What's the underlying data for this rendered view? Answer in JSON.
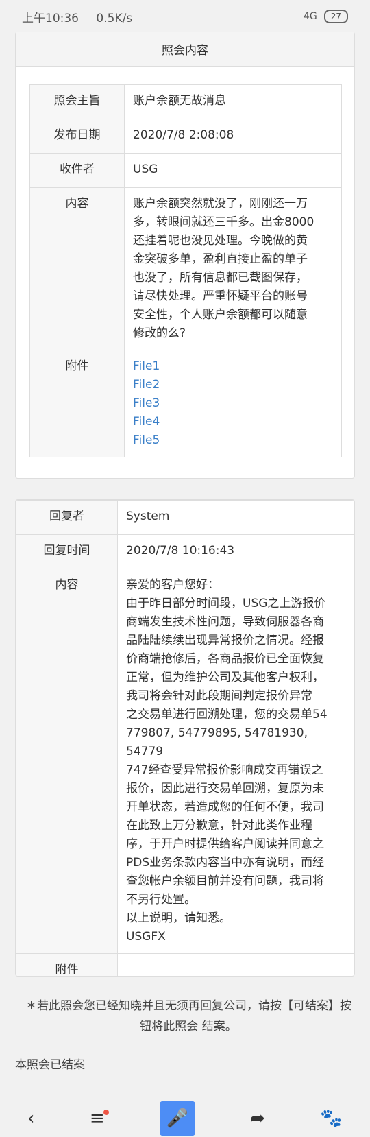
{
  "status": {
    "time": "上午10:36",
    "speed": "0.5K/s",
    "network": "4G",
    "battery": "27"
  },
  "inquiry": {
    "title": "照会内容",
    "subject_label": "照会主旨",
    "subject": "账户余额无故消息",
    "date_label": "发布日期",
    "date": "2020/7/8 2:08:08",
    "recipient_label": "收件者",
    "recipient": "USG",
    "content_label": "内容",
    "content_lines": [
      "账户余额突然就没了，刚刚还一万",
      "多，转眼间就还三千多。出金8000",
      "还挂着呢也没见处理。今晚做的黄",
      "金突破多单，盈利直接止盈的单子",
      "也没了，所有信息都已截图保存，",
      "请尽快处理。严重怀疑平台的账号",
      "安全性，个人账户余额都可以随意",
      "修改的么?"
    ],
    "attachment_label": "附件",
    "files": [
      "File1",
      "File2",
      "File3",
      "File4",
      "File5"
    ]
  },
  "reply": {
    "replier_label": "回复者",
    "replier": "System",
    "time_label": "回复时间",
    "time": "2020/7/8 10:16:43",
    "content_label": "内容",
    "content_lines": [
      "亲爱的客户您好：",
      "由于昨日部分时间段，USG之上游报价",
      "商端发生技术性问题，导致伺服器各商",
      "品陆陆续续出现异常报价之情况。经报",
      "价商端抢修后，各商品报价已全面恢复",
      "正常，但为维护公司及其他客户权利，",
      "我司将会针对此段期间判定报价异常",
      "之交易单进行回溯处理，您的交易单54",
      "779807, 54779895, 54781930, 54779",
      "747经查受异常报价影响成交再错误之",
      "报价，因此进行交易单回溯，复原为未",
      "开单状态，若造成您的任何不便，我司",
      "在此致上万分歉意，针对此类作业程",
      "序，于开户时提供给客户阅读并同意之",
      "PDS业务条款内容当中亦有说明，而经",
      "查您帐户余额目前并没有问题，我司将",
      "不另行处置。",
      "以上说明，请知悉。",
      "USGFX"
    ],
    "attachment_label": "附件"
  },
  "note": "＊若此照会您已经知晓并且无须再回复公司，请按【可结案】按钮将此照会 结案。",
  "closed_text": "本照会已结案",
  "nav": {
    "back": "‹",
    "menu": "≡",
    "mic": "🎤",
    "share": "➦",
    "paw": "🐾"
  }
}
